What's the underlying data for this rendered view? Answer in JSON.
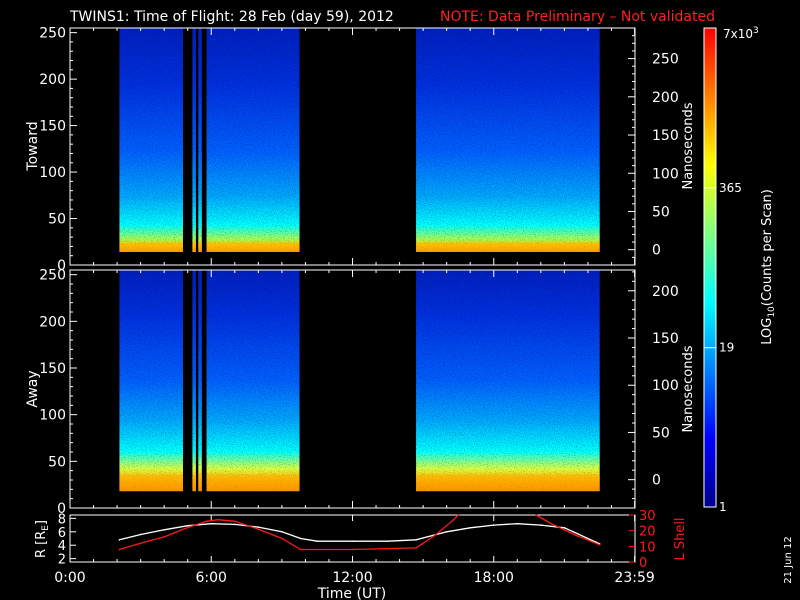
{
  "title": {
    "main": "TWINS1: Time of Flight: 28 Feb (day  59), 2012",
    "note": "NOTE: Data Preliminary – Not validated"
  },
  "colors": {
    "background": "#000000",
    "foreground": "#ffffff",
    "note": "#ff2020",
    "r_line": "#ffffff",
    "lshell_line": "#ff1a1a"
  },
  "colorbar": {
    "label_prefix": "LOG",
    "label_sub": "10",
    "label_suffix": "(Counts per Scan)",
    "ticks": [
      "1",
      "19",
      "365"
    ],
    "top_base": "7x10",
    "top_exp": "3",
    "stops": [
      "#00008b",
      "#0000ff",
      "#0080ff",
      "#00ffff",
      "#80ff80",
      "#ffff00",
      "#ff8000",
      "#ff0000"
    ],
    "range": [
      1,
      7000
    ],
    "scale": "log"
  },
  "timestamp": "21 Jun 12",
  "chart_data": [
    {
      "type": "heatmap",
      "name": "toward",
      "ylabel": "Toward",
      "ylabel_right": "Nanoseconds",
      "ylim": [
        0,
        255
      ],
      "yticks": [
        0,
        50,
        100,
        150,
        200,
        250
      ],
      "ylim_right": [
        -20,
        290
      ],
      "yticks_right": [
        0,
        50,
        100,
        150,
        200,
        250
      ],
      "xlim_hours": [
        0,
        24
      ],
      "data_intervals": [
        [
          2.1,
          4.8
        ],
        [
          5.2,
          5.35
        ],
        [
          5.45,
          5.6
        ],
        [
          5.8,
          9.75
        ],
        [
          14.7,
          22.5
        ]
      ],
      "data_bin_range": [
        14,
        255
      ],
      "peak_bins": [
        14,
        24
      ]
    },
    {
      "type": "heatmap",
      "name": "away",
      "ylabel": "Away",
      "ylabel_right": "Nanoseconds",
      "ylim": [
        0,
        255
      ],
      "yticks": [
        0,
        50,
        100,
        150,
        200,
        250
      ],
      "ylim_right": [
        -30,
        222
      ],
      "yticks_right": [
        0,
        50,
        100,
        150,
        200
      ],
      "xlim_hours": [
        0,
        24
      ],
      "data_intervals": [
        [
          2.1,
          4.8
        ],
        [
          5.2,
          5.35
        ],
        [
          5.45,
          5.6
        ],
        [
          5.8,
          9.75
        ],
        [
          14.7,
          22.5
        ]
      ],
      "data_bin_range": [
        18,
        255
      ],
      "peak_bins": [
        18,
        36
      ]
    },
    {
      "type": "line",
      "name": "ephemeris",
      "ylabel": "R [R",
      "ylabel_sub": "E",
      "ylabel_suffix": "]",
      "ylabel_right": "L Shell",
      "xlabel": "Time (UT)",
      "xtick_labels": [
        "0:00",
        "6:00",
        "12:00",
        "18:00",
        "23:59"
      ],
      "xtick_hours": [
        0,
        6,
        12,
        18,
        23.983
      ],
      "ylim": [
        1.5,
        8.5
      ],
      "yticks": [
        2,
        4,
        6,
        8
      ],
      "ylim_right": [
        0,
        30
      ],
      "yticks_right": [
        0,
        10,
        20,
        30
      ],
      "series": [
        {
          "name": "R",
          "axis": "left",
          "x": [
            2.1,
            3.0,
            4.0,
            5.0,
            6.0,
            7.0,
            8.0,
            9.0,
            9.8,
            10.5,
            12.0,
            13.5,
            14.7,
            16.0,
            17.0,
            18.0,
            19.0,
            20.0,
            21.0,
            22.5
          ],
          "y": [
            4.8,
            5.6,
            6.3,
            6.9,
            7.2,
            7.1,
            6.7,
            6.0,
            5.0,
            4.6,
            4.6,
            4.6,
            4.8,
            6.0,
            6.6,
            7.0,
            7.2,
            7.0,
            6.6,
            4.2
          ]
        },
        {
          "name": "L Shell",
          "axis": "right",
          "x": [
            2.1,
            3.0,
            4.0,
            5.0,
            5.8,
            6.3,
            7.0,
            8.0,
            9.0,
            9.8,
            12.0,
            14.7,
            15.5,
            16.3,
            16.5
          ],
          "y": [
            8,
            12,
            16,
            22,
            26,
            27,
            26,
            21,
            15,
            8,
            8,
            9,
            17,
            27,
            30
          ]
        },
        {
          "name": "L Shell (late)",
          "axis": "right",
          "x": [
            19.8,
            20.5,
            21.5,
            22.5
          ],
          "y": [
            30,
            24,
            17,
            11
          ]
        }
      ]
    }
  ]
}
